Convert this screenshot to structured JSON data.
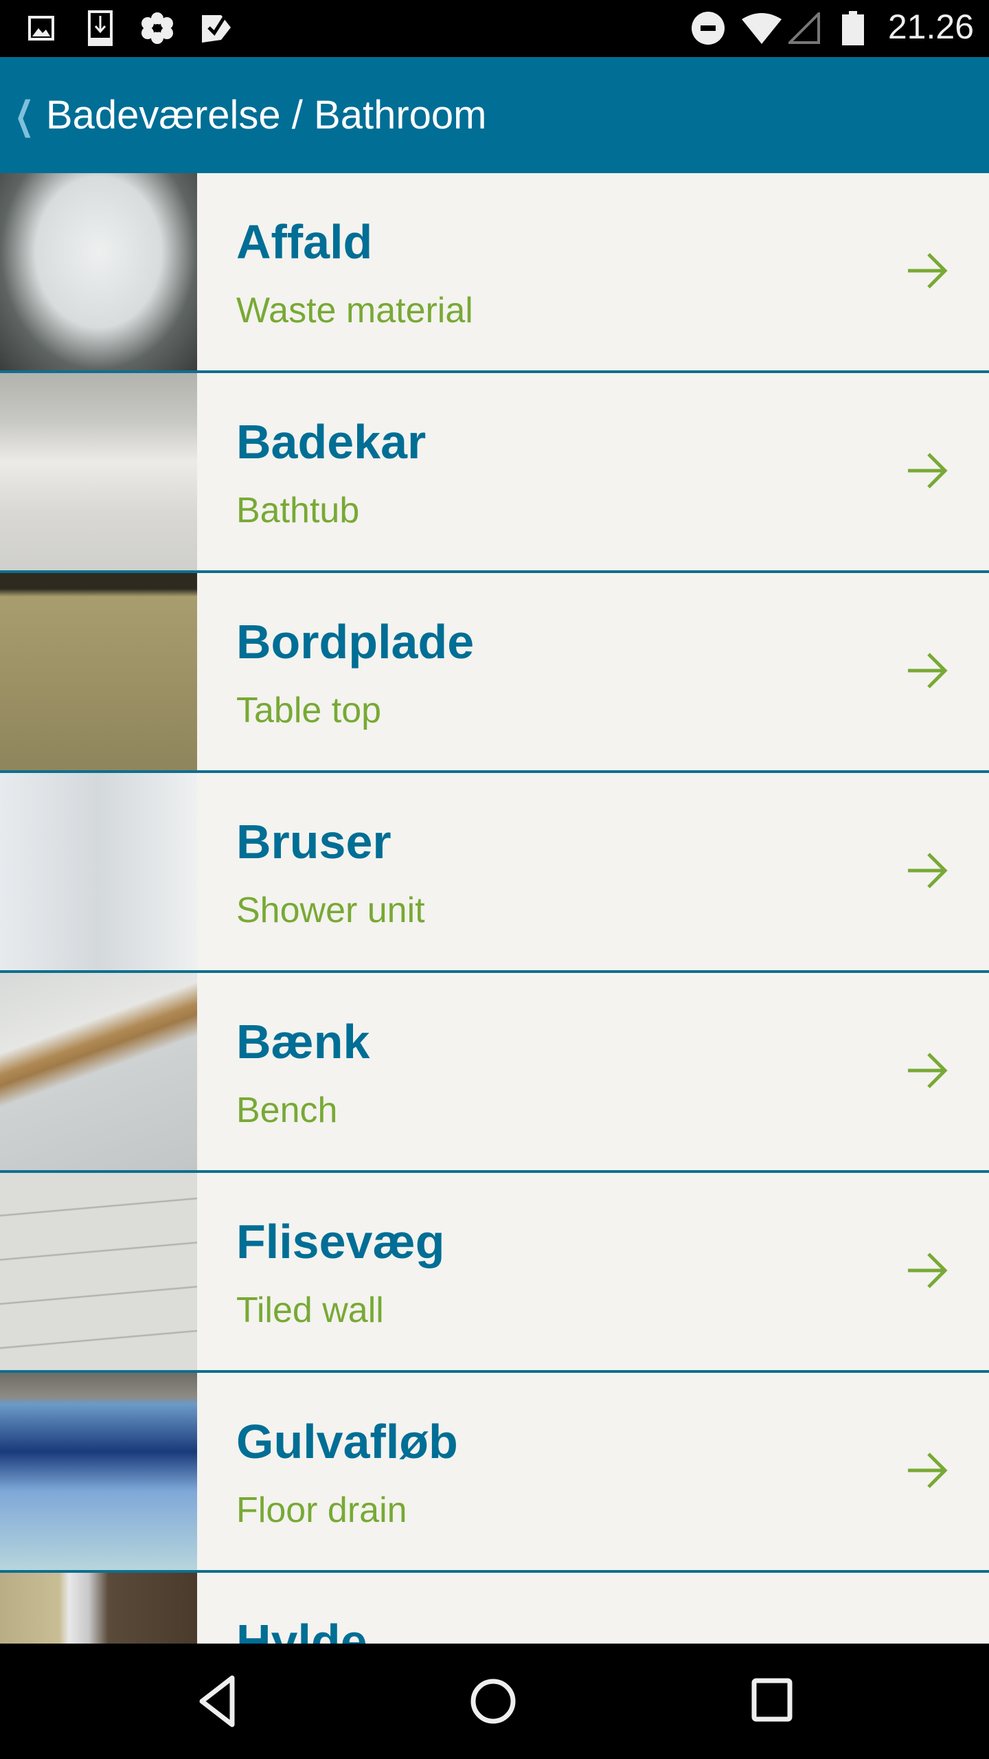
{
  "status_bar": {
    "time": "21.26",
    "icons": [
      "image-icon",
      "download-icon",
      "flower-icon",
      "checklist-icon",
      "do-not-disturb-icon",
      "wifi-icon",
      "signal-icon",
      "battery-icon"
    ]
  },
  "header": {
    "title": "Badeværelse / Bathroom",
    "back_icon": "chevron-left-icon"
  },
  "colors": {
    "accent": "#006e95",
    "subtitle": "#78a935",
    "background": "#f4f3ef"
  },
  "items": [
    {
      "title": "Affald",
      "subtitle": "Waste material"
    },
    {
      "title": "Badekar",
      "subtitle": "Bathtub"
    },
    {
      "title": "Bordplade",
      "subtitle": "Table top"
    },
    {
      "title": "Bruser",
      "subtitle": "Shower unit"
    },
    {
      "title": "Bænk",
      "subtitle": "Bench"
    },
    {
      "title": "Flisevæg",
      "subtitle": "Tiled wall"
    },
    {
      "title": "Gulvafløb",
      "subtitle": "Floor drain"
    },
    {
      "title": "Hylde",
      "subtitle": ""
    }
  ],
  "nav_bar": {
    "icons": [
      "back-icon",
      "home-icon",
      "recents-icon"
    ]
  }
}
